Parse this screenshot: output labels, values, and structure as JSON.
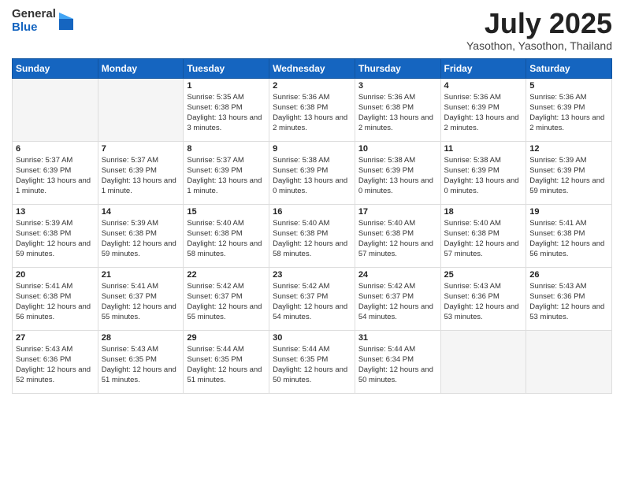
{
  "logo": {
    "general": "General",
    "blue": "Blue"
  },
  "title": "July 2025",
  "subtitle": "Yasothon, Yasothon, Thailand",
  "days_header": [
    "Sunday",
    "Monday",
    "Tuesday",
    "Wednesday",
    "Thursday",
    "Friday",
    "Saturday"
  ],
  "weeks": [
    [
      {
        "day": "",
        "sunrise": "",
        "sunset": "",
        "daylight": "",
        "empty": true
      },
      {
        "day": "",
        "sunrise": "",
        "sunset": "",
        "daylight": "",
        "empty": true
      },
      {
        "day": "1",
        "sunrise": "Sunrise: 5:35 AM",
        "sunset": "Sunset: 6:38 PM",
        "daylight": "Daylight: 13 hours and 3 minutes.",
        "empty": false
      },
      {
        "day": "2",
        "sunrise": "Sunrise: 5:36 AM",
        "sunset": "Sunset: 6:38 PM",
        "daylight": "Daylight: 13 hours and 2 minutes.",
        "empty": false
      },
      {
        "day": "3",
        "sunrise": "Sunrise: 5:36 AM",
        "sunset": "Sunset: 6:38 PM",
        "daylight": "Daylight: 13 hours and 2 minutes.",
        "empty": false
      },
      {
        "day": "4",
        "sunrise": "Sunrise: 5:36 AM",
        "sunset": "Sunset: 6:39 PM",
        "daylight": "Daylight: 13 hours and 2 minutes.",
        "empty": false
      },
      {
        "day": "5",
        "sunrise": "Sunrise: 5:36 AM",
        "sunset": "Sunset: 6:39 PM",
        "daylight": "Daylight: 13 hours and 2 minutes.",
        "empty": false
      }
    ],
    [
      {
        "day": "6",
        "sunrise": "Sunrise: 5:37 AM",
        "sunset": "Sunset: 6:39 PM",
        "daylight": "Daylight: 13 hours and 1 minute.",
        "empty": false
      },
      {
        "day": "7",
        "sunrise": "Sunrise: 5:37 AM",
        "sunset": "Sunset: 6:39 PM",
        "daylight": "Daylight: 13 hours and 1 minute.",
        "empty": false
      },
      {
        "day": "8",
        "sunrise": "Sunrise: 5:37 AM",
        "sunset": "Sunset: 6:39 PM",
        "daylight": "Daylight: 13 hours and 1 minute.",
        "empty": false
      },
      {
        "day": "9",
        "sunrise": "Sunrise: 5:38 AM",
        "sunset": "Sunset: 6:39 PM",
        "daylight": "Daylight: 13 hours and 0 minutes.",
        "empty": false
      },
      {
        "day": "10",
        "sunrise": "Sunrise: 5:38 AM",
        "sunset": "Sunset: 6:39 PM",
        "daylight": "Daylight: 13 hours and 0 minutes.",
        "empty": false
      },
      {
        "day": "11",
        "sunrise": "Sunrise: 5:38 AM",
        "sunset": "Sunset: 6:39 PM",
        "daylight": "Daylight: 13 hours and 0 minutes.",
        "empty": false
      },
      {
        "day": "12",
        "sunrise": "Sunrise: 5:39 AM",
        "sunset": "Sunset: 6:39 PM",
        "daylight": "Daylight: 12 hours and 59 minutes.",
        "empty": false
      }
    ],
    [
      {
        "day": "13",
        "sunrise": "Sunrise: 5:39 AM",
        "sunset": "Sunset: 6:38 PM",
        "daylight": "Daylight: 12 hours and 59 minutes.",
        "empty": false
      },
      {
        "day": "14",
        "sunrise": "Sunrise: 5:39 AM",
        "sunset": "Sunset: 6:38 PM",
        "daylight": "Daylight: 12 hours and 59 minutes.",
        "empty": false
      },
      {
        "day": "15",
        "sunrise": "Sunrise: 5:40 AM",
        "sunset": "Sunset: 6:38 PM",
        "daylight": "Daylight: 12 hours and 58 minutes.",
        "empty": false
      },
      {
        "day": "16",
        "sunrise": "Sunrise: 5:40 AM",
        "sunset": "Sunset: 6:38 PM",
        "daylight": "Daylight: 12 hours and 58 minutes.",
        "empty": false
      },
      {
        "day": "17",
        "sunrise": "Sunrise: 5:40 AM",
        "sunset": "Sunset: 6:38 PM",
        "daylight": "Daylight: 12 hours and 57 minutes.",
        "empty": false
      },
      {
        "day": "18",
        "sunrise": "Sunrise: 5:40 AM",
        "sunset": "Sunset: 6:38 PM",
        "daylight": "Daylight: 12 hours and 57 minutes.",
        "empty": false
      },
      {
        "day": "19",
        "sunrise": "Sunrise: 5:41 AM",
        "sunset": "Sunset: 6:38 PM",
        "daylight": "Daylight: 12 hours and 56 minutes.",
        "empty": false
      }
    ],
    [
      {
        "day": "20",
        "sunrise": "Sunrise: 5:41 AM",
        "sunset": "Sunset: 6:38 PM",
        "daylight": "Daylight: 12 hours and 56 minutes.",
        "empty": false
      },
      {
        "day": "21",
        "sunrise": "Sunrise: 5:41 AM",
        "sunset": "Sunset: 6:37 PM",
        "daylight": "Daylight: 12 hours and 55 minutes.",
        "empty": false
      },
      {
        "day": "22",
        "sunrise": "Sunrise: 5:42 AM",
        "sunset": "Sunset: 6:37 PM",
        "daylight": "Daylight: 12 hours and 55 minutes.",
        "empty": false
      },
      {
        "day": "23",
        "sunrise": "Sunrise: 5:42 AM",
        "sunset": "Sunset: 6:37 PM",
        "daylight": "Daylight: 12 hours and 54 minutes.",
        "empty": false
      },
      {
        "day": "24",
        "sunrise": "Sunrise: 5:42 AM",
        "sunset": "Sunset: 6:37 PM",
        "daylight": "Daylight: 12 hours and 54 minutes.",
        "empty": false
      },
      {
        "day": "25",
        "sunrise": "Sunrise: 5:43 AM",
        "sunset": "Sunset: 6:36 PM",
        "daylight": "Daylight: 12 hours and 53 minutes.",
        "empty": false
      },
      {
        "day": "26",
        "sunrise": "Sunrise: 5:43 AM",
        "sunset": "Sunset: 6:36 PM",
        "daylight": "Daylight: 12 hours and 53 minutes.",
        "empty": false
      }
    ],
    [
      {
        "day": "27",
        "sunrise": "Sunrise: 5:43 AM",
        "sunset": "Sunset: 6:36 PM",
        "daylight": "Daylight: 12 hours and 52 minutes.",
        "empty": false
      },
      {
        "day": "28",
        "sunrise": "Sunrise: 5:43 AM",
        "sunset": "Sunset: 6:35 PM",
        "daylight": "Daylight: 12 hours and 51 minutes.",
        "empty": false
      },
      {
        "day": "29",
        "sunrise": "Sunrise: 5:44 AM",
        "sunset": "Sunset: 6:35 PM",
        "daylight": "Daylight: 12 hours and 51 minutes.",
        "empty": false
      },
      {
        "day": "30",
        "sunrise": "Sunrise: 5:44 AM",
        "sunset": "Sunset: 6:35 PM",
        "daylight": "Daylight: 12 hours and 50 minutes.",
        "empty": false
      },
      {
        "day": "31",
        "sunrise": "Sunrise: 5:44 AM",
        "sunset": "Sunset: 6:34 PM",
        "daylight": "Daylight: 12 hours and 50 minutes.",
        "empty": false
      },
      {
        "day": "",
        "sunrise": "",
        "sunset": "",
        "daylight": "",
        "empty": true
      },
      {
        "day": "",
        "sunrise": "",
        "sunset": "",
        "daylight": "",
        "empty": true
      }
    ]
  ]
}
